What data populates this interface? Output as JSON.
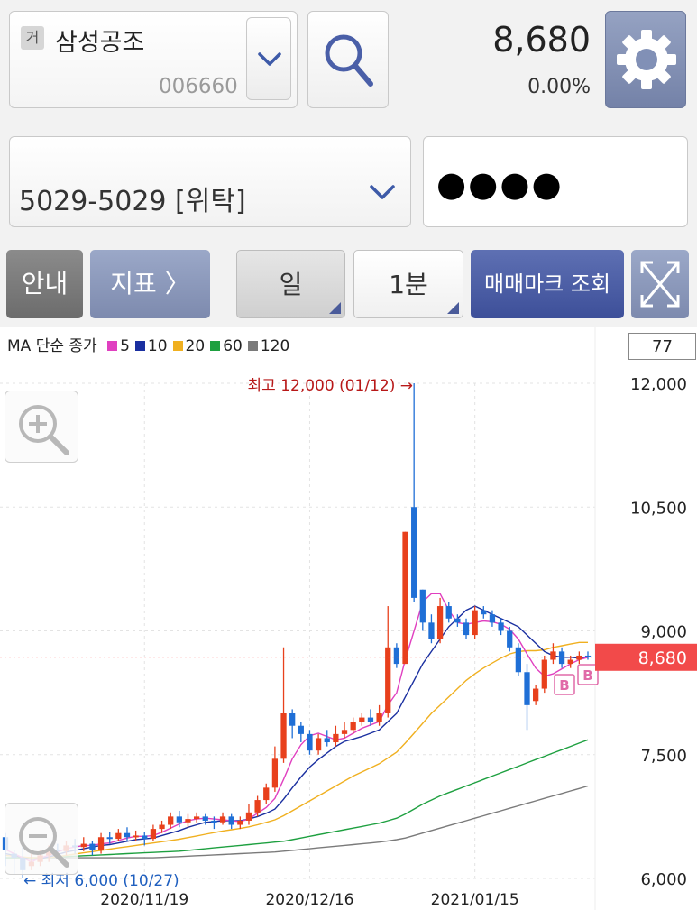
{
  "header": {
    "market_tag": "거",
    "stock_name": "삼성공조",
    "stock_code": "006660",
    "price": "8,680",
    "change": "0.00%"
  },
  "account": {
    "label": "5029-5029 [위탁]",
    "password_mask": "●●●●"
  },
  "toolbar": {
    "guide": "안내",
    "indicator": "지표 〉",
    "period": "일",
    "interval": "1분",
    "trade_mark": "매매마크 조회"
  },
  "legend": {
    "prefix": "MA 단순 종가",
    "items": [
      {
        "label": "5",
        "color": "#e040c0"
      },
      {
        "label": "10",
        "color": "#1a2fa0"
      },
      {
        "label": "20",
        "color": "#f0b020"
      },
      {
        "label": "60",
        "color": "#1ea040"
      },
      {
        "label": "120",
        "color": "#7a7a7a"
      }
    ]
  },
  "period_count": "77",
  "chart_data": {
    "type": "candlestick",
    "ylim": [
      6000,
      12000
    ],
    "yticks": [
      "12,000",
      "10,500",
      "9,000",
      "7,500",
      "6,000"
    ],
    "xticks": [
      "2020/11/19",
      "2020/12/16",
      "2021/01/15"
    ],
    "current_price": "8,680",
    "high_annotation": "최고 12,000 (01/12) →",
    "low_annotation": "← 최저 6,000 (10/27)",
    "trade_marks": [
      "B",
      "B"
    ],
    "candles": [
      [
        6500,
        6350,
        6550,
        6150
      ],
      [
        6300,
        6250,
        6350,
        6050
      ],
      [
        6250,
        6100,
        6400,
        6000
      ],
      [
        6150,
        6200,
        6300,
        6100
      ],
      [
        6200,
        6280,
        6350,
        6150
      ],
      [
        6280,
        6350,
        6400,
        6200
      ],
      [
        6350,
        6330,
        6420,
        6250
      ],
      [
        6330,
        6400,
        6450,
        6280
      ],
      [
        6400,
        6380,
        6480,
        6300
      ],
      [
        6380,
        6420,
        6500,
        6330
      ],
      [
        6420,
        6350,
        6450,
        6280
      ],
      [
        6350,
        6500,
        6550,
        6300
      ],
      [
        6500,
        6480,
        6560,
        6420
      ],
      [
        6480,
        6550,
        6600,
        6450
      ],
      [
        6550,
        6500,
        6620,
        6450
      ],
      [
        6500,
        6520,
        6580,
        6450
      ],
      [
        6520,
        6480,
        6560,
        6400
      ],
      [
        6480,
        6600,
        6650,
        6450
      ],
      [
        6600,
        6650,
        6700,
        6550
      ],
      [
        6650,
        6750,
        6800,
        6600
      ],
      [
        6750,
        6680,
        6820,
        6620
      ],
      [
        6680,
        6720,
        6780,
        6620
      ],
      [
        6720,
        6750,
        6800,
        6680
      ],
      [
        6750,
        6700,
        6780,
        6650
      ],
      [
        6700,
        6680,
        6750,
        6600
      ],
      [
        6680,
        6750,
        6800,
        6650
      ],
      [
        6750,
        6650,
        6780,
        6600
      ],
      [
        6650,
        6700,
        6750,
        6600
      ],
      [
        6700,
        6800,
        6900,
        6650
      ],
      [
        6800,
        6950,
        7000,
        6750
      ],
      [
        6950,
        7100,
        7150,
        6900
      ],
      [
        7100,
        7450,
        7600,
        7050
      ],
      [
        7450,
        8000,
        8800,
        7400
      ],
      [
        8000,
        7850,
        8050,
        7700
      ],
      [
        7850,
        7750,
        7900,
        7650
      ],
      [
        7750,
        7550,
        7800,
        7500
      ],
      [
        7550,
        7700,
        7750,
        7500
      ],
      [
        7700,
        7650,
        7800,
        7600
      ],
      [
        7650,
        7750,
        7850,
        7600
      ],
      [
        7750,
        7800,
        7900,
        7700
      ],
      [
        7800,
        7900,
        7950,
        7750
      ],
      [
        7900,
        7950,
        8000,
        7850
      ],
      [
        7950,
        7900,
        8050,
        7850
      ],
      [
        7900,
        8000,
        8100,
        7850
      ],
      [
        8000,
        8800,
        9300,
        7950
      ],
      [
        8800,
        8600,
        8850,
        8550
      ],
      [
        8600,
        10200,
        10200,
        8600
      ],
      [
        10500,
        9400,
        12000,
        9350
      ],
      [
        9500,
        9100,
        9500,
        9000
      ],
      [
        9100,
        8900,
        9200,
        8850
      ],
      [
        8900,
        9300,
        9400,
        8850
      ],
      [
        9300,
        9150,
        9350,
        9100
      ],
      [
        9150,
        9100,
        9200,
        9050
      ],
      [
        9100,
        8950,
        9150,
        8900
      ],
      [
        8950,
        9250,
        9300,
        8900
      ],
      [
        9250,
        9200,
        9300,
        9150
      ],
      [
        9200,
        9100,
        9250,
        9050
      ],
      [
        9100,
        9000,
        9150,
        8950
      ],
      [
        9000,
        8800,
        9050,
        8750
      ],
      [
        8800,
        8500,
        8850,
        8450
      ],
      [
        8500,
        8100,
        8600,
        7800
      ],
      [
        8150,
        8300,
        8350,
        8100
      ],
      [
        8300,
        8650,
        8700,
        8250
      ],
      [
        8650,
        8750,
        8850,
        8600
      ],
      [
        8750,
        8600,
        8800,
        8550
      ],
      [
        8600,
        8650,
        8700,
        8550
      ],
      [
        8650,
        8700,
        8750,
        8600
      ],
      [
        8700,
        8680,
        8750,
        8650
      ]
    ],
    "ma": {
      "5": [
        6350,
        6300,
        6250,
        6200,
        6250,
        6280,
        6320,
        6360,
        6380,
        6400,
        6400,
        6420,
        6430,
        6460,
        6490,
        6510,
        6510,
        6520,
        6560,
        6610,
        6660,
        6700,
        6720,
        6730,
        6720,
        6710,
        6700,
        6690,
        6720,
        6790,
        6860,
        6970,
        7200,
        7450,
        7620,
        7730,
        7760,
        7720,
        7680,
        7700,
        7760,
        7820,
        7860,
        7900,
        8100,
        8250,
        8650,
        9000,
        9350,
        9450,
        9450,
        9250,
        9100,
        9080,
        9100,
        9120,
        9110,
        9080,
        9020,
        8900,
        8720,
        8550,
        8450,
        8480,
        8540,
        8600,
        8650,
        8680
      ],
      "10": [
        6300,
        6280,
        6250,
        6230,
        6240,
        6260,
        6290,
        6320,
        6340,
        6360,
        6380,
        6400,
        6410,
        6430,
        6450,
        6470,
        6480,
        6490,
        6520,
        6550,
        6580,
        6620,
        6650,
        6680,
        6690,
        6700,
        6700,
        6700,
        6720,
        6750,
        6790,
        6840,
        6960,
        7100,
        7230,
        7350,
        7440,
        7520,
        7600,
        7660,
        7690,
        7720,
        7760,
        7800,
        7900,
        8000,
        8200,
        8400,
        8600,
        8750,
        8900,
        9050,
        9150,
        9250,
        9300,
        9250,
        9200,
        9150,
        9100,
        9050,
        8950,
        8850,
        8750,
        8700,
        8680,
        8680,
        8670,
        8680
      ],
      "20": [
        6280,
        6270,
        6260,
        6250,
        6250,
        6255,
        6265,
        6280,
        6295,
        6310,
        6325,
        6340,
        6355,
        6370,
        6385,
        6400,
        6415,
        6430,
        6445,
        6460,
        6475,
        6495,
        6515,
        6535,
        6555,
        6575,
        6590,
        6605,
        6625,
        6650,
        6680,
        6710,
        6760,
        6820,
        6880,
        6940,
        7000,
        7060,
        7120,
        7180,
        7240,
        7290,
        7340,
        7390,
        7460,
        7530,
        7640,
        7760,
        7880,
        8000,
        8100,
        8200,
        8300,
        8400,
        8480,
        8550,
        8610,
        8670,
        8720,
        8750,
        8760,
        8760,
        8770,
        8800,
        8820,
        8840,
        8860,
        8860
      ],
      "60": [
        6250,
        6250,
        6250,
        6250,
        6250,
        6255,
        6260,
        6265,
        6270,
        6275,
        6280,
        6285,
        6290,
        6295,
        6300,
        6305,
        6310,
        6315,
        6320,
        6325,
        6330,
        6340,
        6350,
        6360,
        6370,
        6380,
        6390,
        6400,
        6410,
        6420,
        6430,
        6440,
        6450,
        6470,
        6490,
        6510,
        6530,
        6550,
        6570,
        6590,
        6610,
        6630,
        6650,
        6670,
        6700,
        6730,
        6780,
        6840,
        6900,
        6950,
        7000,
        7040,
        7080,
        7120,
        7160,
        7200,
        7240,
        7280,
        7320,
        7360,
        7400,
        7440,
        7480,
        7520,
        7560,
        7600,
        7640,
        7680
      ],
      "120": [
        6250,
        6250,
        6250,
        6250,
        6250,
        6250,
        6250,
        6250,
        6250,
        6250,
        6250,
        6250,
        6250,
        6250,
        6250,
        6250,
        6250,
        6250,
        6255,
        6260,
        6265,
        6270,
        6275,
        6280,
        6285,
        6290,
        6295,
        6300,
        6305,
        6310,
        6315,
        6320,
        6330,
        6340,
        6350,
        6360,
        6370,
        6380,
        6390,
        6400,
        6410,
        6420,
        6430,
        6440,
        6455,
        6470,
        6490,
        6520,
        6550,
        6580,
        6610,
        6640,
        6670,
        6700,
        6730,
        6760,
        6790,
        6820,
        6850,
        6880,
        6910,
        6940,
        6970,
        7000,
        7030,
        7060,
        7090,
        7120
      ]
    }
  }
}
